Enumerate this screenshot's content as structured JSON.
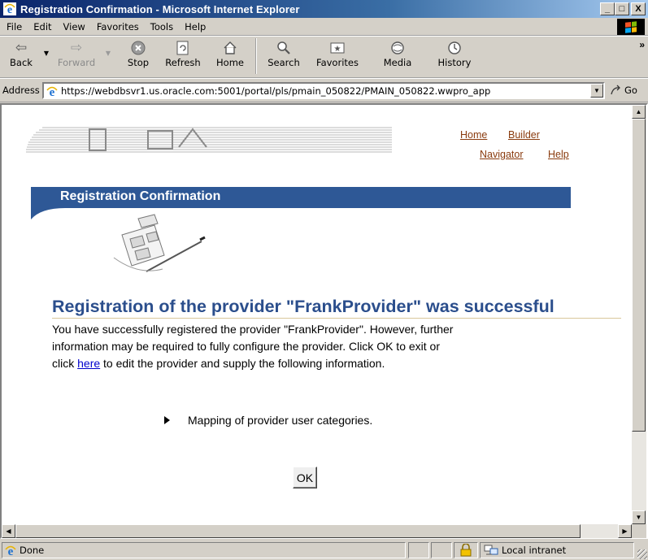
{
  "window": {
    "title": "Registration Confirmation - Microsoft Internet Explorer",
    "minimize": "_",
    "maximize": "□",
    "close": "X"
  },
  "menu": {
    "items": [
      "File",
      "Edit",
      "View",
      "Favorites",
      "Tools",
      "Help"
    ]
  },
  "toolbar": {
    "back": "Back",
    "forward": "Forward",
    "stop": "Stop",
    "refresh": "Refresh",
    "home": "Home",
    "search": "Search",
    "favorites": "Favorites",
    "media": "Media",
    "history": "History",
    "more": "»"
  },
  "address": {
    "label": "Address",
    "url": "https://webdbsvr1.us.oracle.com:5001/portal/pls/pmain_050822/PMAIN_050822.wwpro_app",
    "go": "Go"
  },
  "page": {
    "links": {
      "home": "Home",
      "builder": "Builder",
      "navigator": "Navigator",
      "help": "Help"
    },
    "banner_title": "Registration Confirmation",
    "heading": "Registration of the provider \"FrankProvider\" was successful",
    "body_line1": "You have successfully registered the provider \"FrankProvider\". However, further",
    "body_line2": "information may be required to fully configure the provider. Click OK to exit or",
    "body_pre_link": "click ",
    "body_link": "here",
    "body_post_link": " to edit the provider and supply the following information.",
    "bullet_item": "Mapping of provider user categories.",
    "ok": "OK"
  },
  "status": {
    "text": "Done",
    "zone": "Local intranet"
  },
  "colors": {
    "banner": "#2e5896",
    "heading": "#2b4e8c",
    "nav_link": "#8a3b0e",
    "body_link": "#0000cc"
  }
}
